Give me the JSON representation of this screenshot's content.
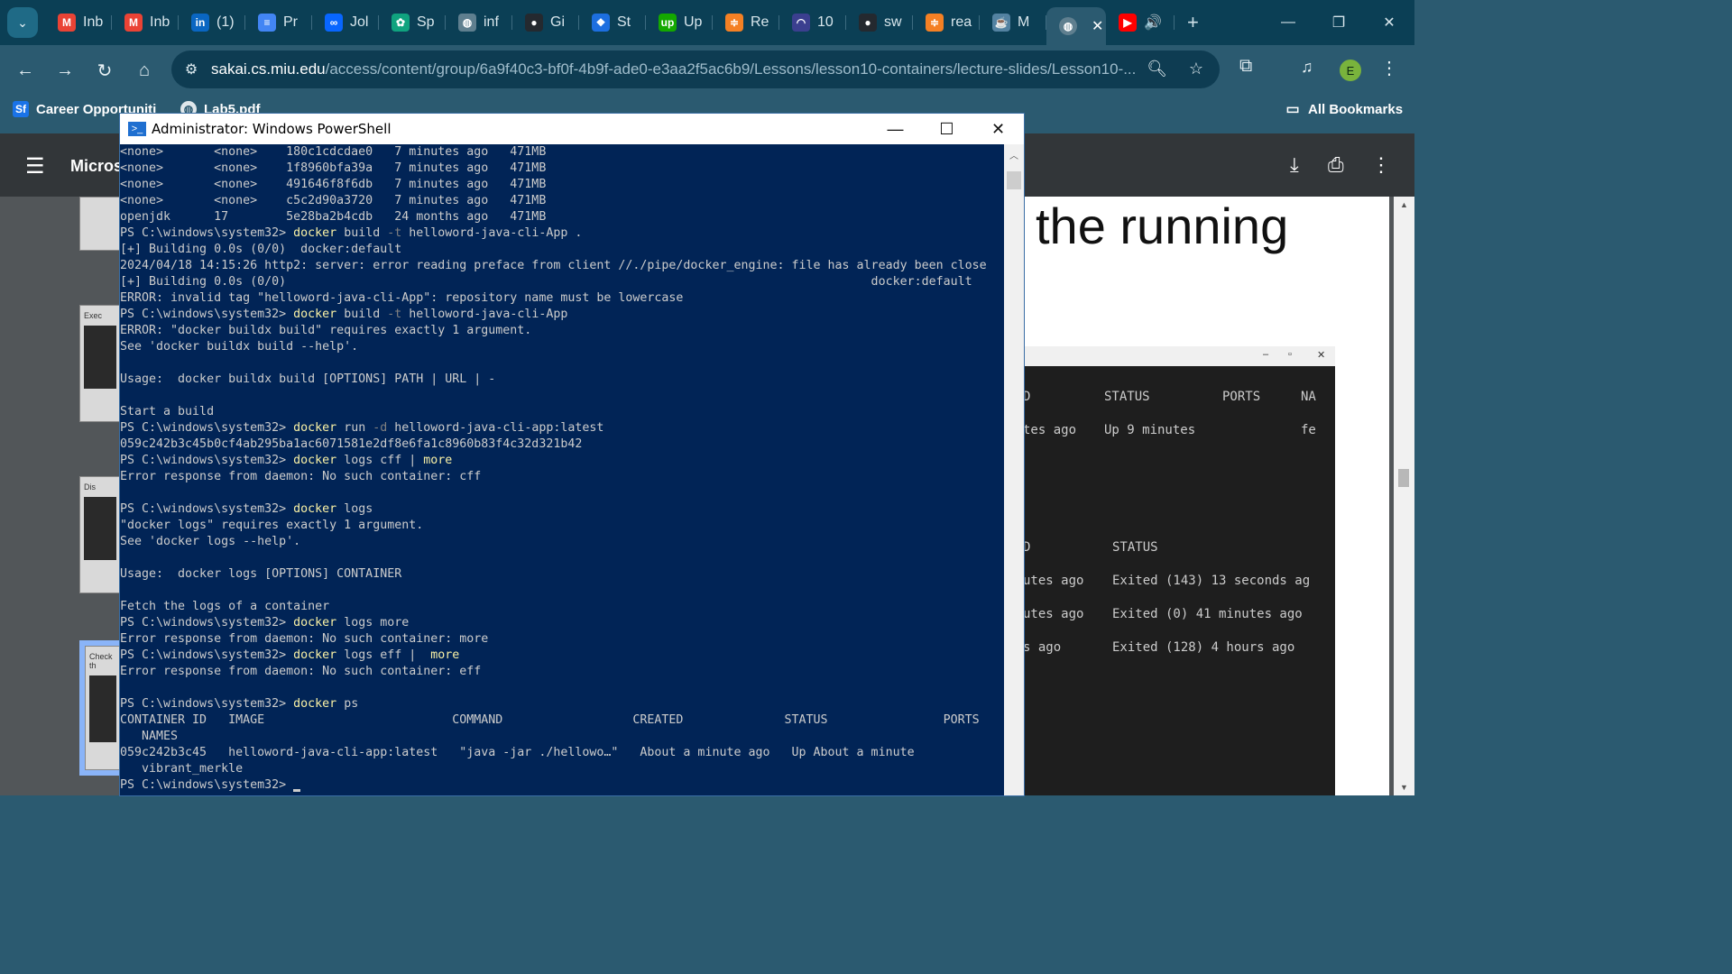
{
  "browser": {
    "tabs": [
      {
        "label": "Inb",
        "icon": "gmail-icon",
        "color": "#ea4335",
        "glyph": "M"
      },
      {
        "label": "Inb",
        "icon": "gmail-icon",
        "color": "#ea4335",
        "glyph": "M"
      },
      {
        "label": "(1)",
        "icon": "linkedin-icon",
        "color": "#0a66c2",
        "glyph": "in"
      },
      {
        "label": "Pr",
        "icon": "docs-icon",
        "color": "#4285f4",
        "glyph": "≡"
      },
      {
        "label": "Jol",
        "icon": "meta-icon",
        "color": "#0866ff",
        "glyph": "∞"
      },
      {
        "label": "Sp",
        "icon": "chatgpt-icon",
        "color": "#10a37f",
        "glyph": "✿"
      },
      {
        "label": "inf",
        "icon": "globe-icon",
        "color": "#5f7f8f",
        "glyph": "◍"
      },
      {
        "label": "Gi",
        "icon": "github-icon",
        "color": "#24292f",
        "glyph": "●"
      },
      {
        "label": "St",
        "icon": "bluebird-icon",
        "color": "#1d6fe0",
        "glyph": "❖"
      },
      {
        "label": "Up",
        "icon": "upwork-icon",
        "color": "#14a800",
        "glyph": "up"
      },
      {
        "label": "Re",
        "icon": "stackoverflow-icon",
        "color": "#f48024",
        "glyph": "≑"
      },
      {
        "label": "10",
        "icon": "gauge-icon",
        "color": "#3b3f8f",
        "glyph": "◠"
      },
      {
        "label": "sw",
        "icon": "github-icon",
        "color": "#24292f",
        "glyph": "●"
      },
      {
        "label": "rea",
        "icon": "stackoverflow-icon",
        "color": "#f48024",
        "glyph": "≑"
      },
      {
        "label": "M",
        "icon": "java-icon",
        "color": "#5382a1",
        "glyph": "☕"
      }
    ],
    "active_tab": {
      "icon": "globe-icon",
      "close": "✕"
    },
    "audio_tab": {
      "icon": "youtube-icon",
      "speaker": "🔊"
    },
    "new_tab": "+",
    "window_controls": {
      "minimize": "—",
      "restore": "❐",
      "close": "✕"
    },
    "url_host": "sakai.cs.miu.edu",
    "url_path": "/access/content/group/6a9f40c3-bf0f-4b9f-ade0-e3aa2f5ac6b9/Lessons/lesson10-containers/lecture-slides/Lesson10-...",
    "avatar_letter": "E",
    "bookmarks": {
      "career": "Career Opportuniti",
      "lab": "Lab5.pdf",
      "all": "All Bookmarks"
    }
  },
  "pdf": {
    "title": "Micros",
    "page_heading": "the running",
    "thumbs": [
      "",
      "Exec",
      "Dis",
      "Check th"
    ]
  },
  "slide_terminal": {
    "header": {
      "id": "D",
      "status": "STATUS",
      "ports": "PORTS",
      "names": "NA"
    },
    "row1": {
      "created": "tes ago",
      "status": "Up 9 minutes",
      "name": "fe"
    },
    "header2": {
      "id": "D",
      "status": "STATUS"
    },
    "rows": [
      {
        "created": "utes ago",
        "status": "Exited (143) 13 seconds ag"
      },
      {
        "created": "utes ago",
        "status": "Exited (0) 41 minutes ago"
      },
      {
        "created": "s ago",
        "status": "Exited (128) 4 hours ago"
      }
    ]
  },
  "powershell": {
    "title": "Administrator: Windows PowerShell",
    "lines": [
      [
        {
          "t": "<none>       <none>    180c1cdcdae0   7 minutes ago   471MB"
        }
      ],
      [
        {
          "t": "<none>       <none>    1f8960bfa39a   7 minutes ago   471MB"
        }
      ],
      [
        {
          "t": "<none>       <none>    491646f8f6db   7 minutes ago   471MB"
        }
      ],
      [
        {
          "t": "<none>       <none>    c5c2d90a3720   7 minutes ago   471MB"
        }
      ],
      [
        {
          "t": "openjdk      17        5e28ba2b4cdb   24 months ago   471MB"
        }
      ],
      [
        {
          "t": "PS C:\\windows\\system32> "
        },
        {
          "t": "docker",
          "c": "cmd"
        },
        {
          "t": " build "
        },
        {
          "t": "-t",
          "c": "flag"
        },
        {
          "t": " helloword-java-cli-App ."
        }
      ],
      [
        {
          "t": "[+] Building 0.0s (0/0)  docker:default"
        }
      ],
      [
        {
          "t": "2024/04/18 14:15:26 http2: server: error reading preface from client //./pipe/docker_engine: file has already been close"
        }
      ],
      [
        {
          "t": "[+] Building 0.0s (0/0)                                                                                 docker:default"
        }
      ],
      [
        {
          "t": "ERROR: invalid tag \"helloword-java-cli-App\": repository name must be lowercase"
        }
      ],
      [
        {
          "t": "PS C:\\windows\\system32> "
        },
        {
          "t": "docker",
          "c": "cmd"
        },
        {
          "t": " build "
        },
        {
          "t": "-t",
          "c": "flag"
        },
        {
          "t": " helloword-java-cli-App"
        }
      ],
      [
        {
          "t": "ERROR: \"docker buildx build\" requires exactly 1 argument."
        }
      ],
      [
        {
          "t": "See 'docker buildx build --help'."
        }
      ],
      [
        {
          "t": ""
        }
      ],
      [
        {
          "t": "Usage:  docker buildx build [OPTIONS] PATH | URL | -"
        }
      ],
      [
        {
          "t": ""
        }
      ],
      [
        {
          "t": "Start a build"
        }
      ],
      [
        {
          "t": "PS C:\\windows\\system32> "
        },
        {
          "t": "docker",
          "c": "cmd"
        },
        {
          "t": " run "
        },
        {
          "t": "-d",
          "c": "flag"
        },
        {
          "t": " helloword-java-cli-app:latest"
        }
      ],
      [
        {
          "t": "059c242b3c45b0cf4ab295ba1ac6071581e2df8e6fa1c8960b83f4c32d321b42"
        }
      ],
      [
        {
          "t": "PS C:\\windows\\system32> "
        },
        {
          "t": "docker",
          "c": "cmd"
        },
        {
          "t": " logs cff | "
        },
        {
          "t": "more",
          "c": "cmd"
        }
      ],
      [
        {
          "t": "Error response from daemon: No such container: cff"
        }
      ],
      [
        {
          "t": ""
        }
      ],
      [
        {
          "t": "PS C:\\windows\\system32> "
        },
        {
          "t": "docker",
          "c": "cmd"
        },
        {
          "t": " logs"
        }
      ],
      [
        {
          "t": "\"docker logs\" requires exactly 1 argument."
        }
      ],
      [
        {
          "t": "See 'docker logs --help'."
        }
      ],
      [
        {
          "t": ""
        }
      ],
      [
        {
          "t": "Usage:  docker logs [OPTIONS] CONTAINER"
        }
      ],
      [
        {
          "t": ""
        }
      ],
      [
        {
          "t": "Fetch the logs of a container"
        }
      ],
      [
        {
          "t": "PS C:\\windows\\system32> "
        },
        {
          "t": "docker",
          "c": "cmd"
        },
        {
          "t": " logs more"
        }
      ],
      [
        {
          "t": "Error response from daemon: No such container: more"
        }
      ],
      [
        {
          "t": "PS C:\\windows\\system32> "
        },
        {
          "t": "docker",
          "c": "cmd"
        },
        {
          "t": " logs eff |  "
        },
        {
          "t": "more",
          "c": "cmd"
        }
      ],
      [
        {
          "t": "Error response from daemon: No such container: eff"
        }
      ],
      [
        {
          "t": ""
        }
      ],
      [
        {
          "t": "PS C:\\windows\\system32> "
        },
        {
          "t": "docker",
          "c": "cmd"
        },
        {
          "t": " ps"
        }
      ],
      [
        {
          "t": "CONTAINER ID   IMAGE                          COMMAND                  CREATED              STATUS                PORTS"
        }
      ],
      [
        {
          "t": "   NAMES"
        }
      ],
      [
        {
          "t": "059c242b3c45   helloword-java-cli-app:latest   \"java -jar ./hellowo…\"   About a minute ago   Up About a minute"
        }
      ],
      [
        {
          "t": "   vibrant_merkle"
        }
      ],
      [
        {
          "t": "PS C:\\windows\\system32> "
        },
        {
          "t": "",
          "c": "cursor"
        }
      ]
    ]
  }
}
